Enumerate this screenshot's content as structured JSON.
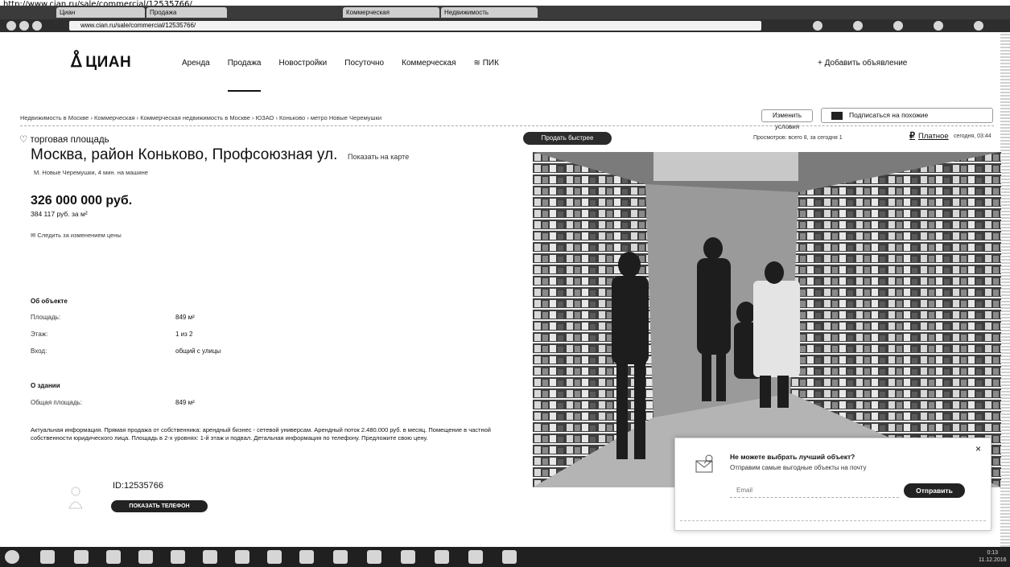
{
  "browser": {
    "caption": "http://www.cian.ru/sale/commercial/12535766/",
    "tabs": [
      "Циан",
      "Продажа",
      "Коммерческая",
      "Недвижимость"
    ],
    "address": "www.cian.ru/sale/commercial/12535766/"
  },
  "header": {
    "logo": "ЦИАН",
    "nav": [
      "Аренда",
      "Продажа",
      "Новостройки",
      "Посуточно",
      "Коммерческая",
      "ПИК"
    ],
    "active_nav": "Продажа",
    "add_listing": "+ Добавить объявление"
  },
  "breadcrumb": "Недвижимость в Москве  ›  Коммерческая  ›  Коммерческая недвижимость в Москве  ›  ЮЗАО  ›  Коньково  ›  метро Новые Черемушки",
  "actions": {
    "change_conditions": "Изменить условия",
    "subscribe": "Подписаться на похожие"
  },
  "listing": {
    "type": "торговая площадь",
    "address": "Москва, район Коньково, Профсоюзная ул.",
    "show_on_map": "Показать на карте",
    "metro": "М. Новые Черемушки, 4 мин. на машине",
    "price": "326 000 000 руб.",
    "price_per_m2": "384 117 руб. за м²",
    "follow_price": "✉ Следить за изменением цены",
    "about_object_title": "Об объекте",
    "about_object": [
      {
        "key": "Площадь:",
        "value": "849 м²"
      },
      {
        "key": "Этаж:",
        "value": "1 из 2"
      },
      {
        "key": "Вход:",
        "value": "общий с улицы"
      }
    ],
    "about_building_title": "О здании",
    "about_building": [
      {
        "key": "Общая площадь:",
        "value": "849 м²"
      }
    ],
    "description": "Актуальная информация. Прямая продажа от собственника: арендный бизнес - сетевой универсам. Арендный поток 2.480.000 руб. в месяц. Помещение в частной собственности юридического лица. Площадь в 2-х уровнях: 1-й этаж и подвал. Детальная информация по телефону. Предложите свою цену.",
    "id": "ID:12535766",
    "show_phone": "ПОКАЗАТЬ ТЕЛЕФОН"
  },
  "right_panel": {
    "quick_sell": "Продать быстрее",
    "views": "Просмотров: всего 8, за сегодня 1",
    "paid": "Платное",
    "date": "сегодня, 03:44"
  },
  "popup": {
    "title": "Не можете выбрать лучший объект?",
    "subtitle": "Отправим самые выгодные объекты на почту",
    "email_placeholder": "Email",
    "send": "Отправить",
    "close": "×"
  },
  "taskbar": {
    "time": "0:13",
    "date": "11.12.2016"
  }
}
